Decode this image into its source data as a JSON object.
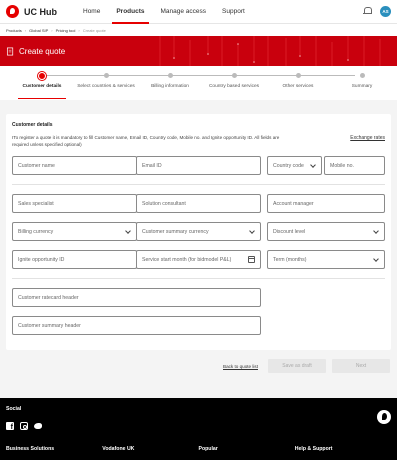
{
  "nav": {
    "brand": "UC Hub",
    "links": [
      "Home",
      "Products",
      "Manage access",
      "Support"
    ],
    "active_index": 1,
    "avatar_initials": "AS",
    "brand_color": "#e60000"
  },
  "breadcrumb": [
    "Products",
    "Global SIP",
    "Pricing tool",
    "Create quote"
  ],
  "hero": {
    "title": "Create quote",
    "background": "#c9000d"
  },
  "stepper": {
    "steps": [
      "Customer details",
      "Select countries & services",
      "Billing information",
      "Country based services",
      "Other services",
      "Summary"
    ],
    "active_index": 0
  },
  "form": {
    "section_title": "Customer details",
    "intro": "ITo register a quote it is mandatory to fill Customer name, Email ID, Country code, Mobile no. and Ignite opportunity ID. All fields are required unless specified optional)",
    "exchange_rates": "Exchange rates",
    "customer_name": "Customer name",
    "email": "Email ID",
    "country_code": "Country code",
    "mobile": "Mobile no.",
    "sales_specialist": "Sales specialist",
    "solution_consultant": "Solution consultant",
    "account_manager": "Account manager",
    "billing_currency": "Billing currency",
    "summary_currency": "Customer summary currency",
    "discount_level": "Discount level",
    "ignite_id": "Ignite opportunity ID",
    "service_start": "Service start month (for bidmodel P&L)",
    "term": "Term (months)",
    "ratecard_header": "Customer ratecard header",
    "summary_header": "Customer summary header"
  },
  "actions": {
    "back": "Back to quote list",
    "save_draft": "Save as draft",
    "next": "Next"
  },
  "footer": {
    "social_title": "Social",
    "social_icons": [
      "facebook-icon",
      "instagram-icon",
      "twitter-icon"
    ],
    "columns": [
      "Business Solutions",
      "Vodafone UK",
      "Popular",
      "Help & Support"
    ]
  }
}
